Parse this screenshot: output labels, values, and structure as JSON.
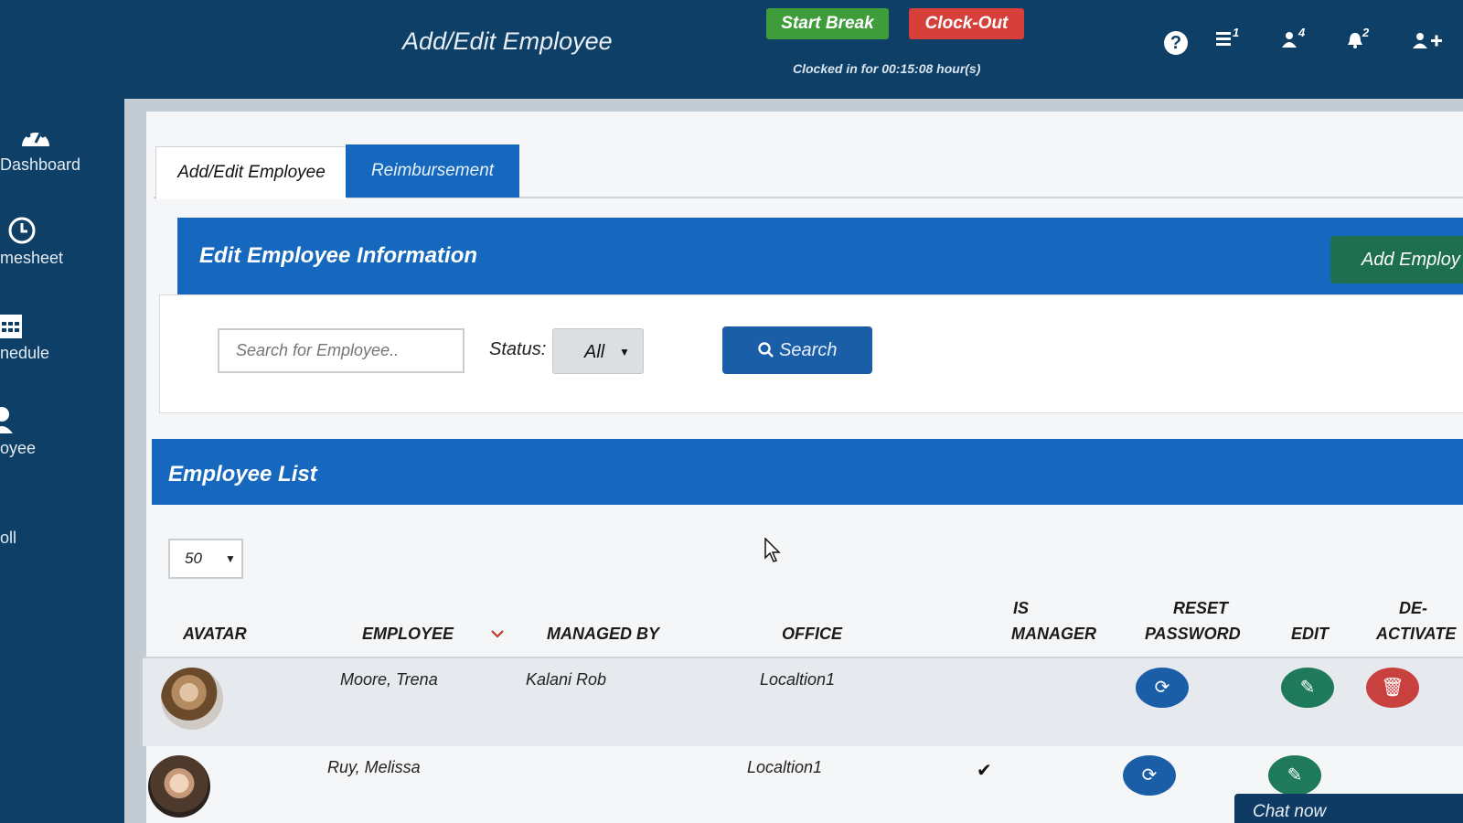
{
  "header": {
    "title": "Add/Edit Employee",
    "start_break": "Start Break",
    "clock_out": "Clock-Out",
    "clocked_in": "Clocked in for 00:15:08 hour(s)",
    "icons": [
      {
        "name": "help-icon",
        "glyph": "?"
      },
      {
        "name": "tasks-icon",
        "badge": "1"
      },
      {
        "name": "users-icon",
        "badge": "4"
      },
      {
        "name": "bell-icon",
        "badge": "2"
      },
      {
        "name": "add-user-icon"
      }
    ]
  },
  "sidebar": {
    "items": [
      {
        "label": "Dashboard",
        "icon": "dashboard-icon"
      },
      {
        "label": "mesheet",
        "icon": "clock-icon"
      },
      {
        "label": "nedule",
        "icon": "calendar-icon"
      },
      {
        "label": "oyee",
        "icon": "user-icon"
      },
      {
        "label": "oll",
        "icon": ""
      }
    ]
  },
  "tabs": [
    {
      "label": "Add/Edit Employee",
      "active": true
    },
    {
      "label": "Reimbursement",
      "active": false
    }
  ],
  "edit_section": {
    "title": "Edit Employee Information",
    "add_button": "Add Employ"
  },
  "search": {
    "placeholder": "Search for Employee..",
    "status_label": "Status:",
    "status_value": "All",
    "button": "Search"
  },
  "list": {
    "title": "Employee List",
    "per_page": "50",
    "columns": {
      "avatar": "AVATAR",
      "employee": "EMPLOYEE",
      "managed_by": "MANAGED BY",
      "office": "OFFICE",
      "is_manager_1": "IS",
      "is_manager_2": "MANAGER",
      "reset_1": "RESET",
      "reset_2": "PASSWORD",
      "edit": "EDIT",
      "deactivate_1": "DE-",
      "deactivate_2": "ACTIVATE"
    },
    "rows": [
      {
        "employee": "Moore, Trena",
        "managed_by": "Kalani Rob",
        "office": "Localtion1",
        "is_manager": ""
      },
      {
        "employee": "Ruy, Melissa",
        "managed_by": "",
        "office": "Localtion1",
        "is_manager": "✔"
      }
    ]
  },
  "chat": {
    "label": "Chat now"
  },
  "colors": {
    "navy": "#0e3f66",
    "primary_blue": "#1568bd",
    "green": "#3f9c3a",
    "red": "#d7403a",
    "teal_green": "#1e7a5a"
  }
}
